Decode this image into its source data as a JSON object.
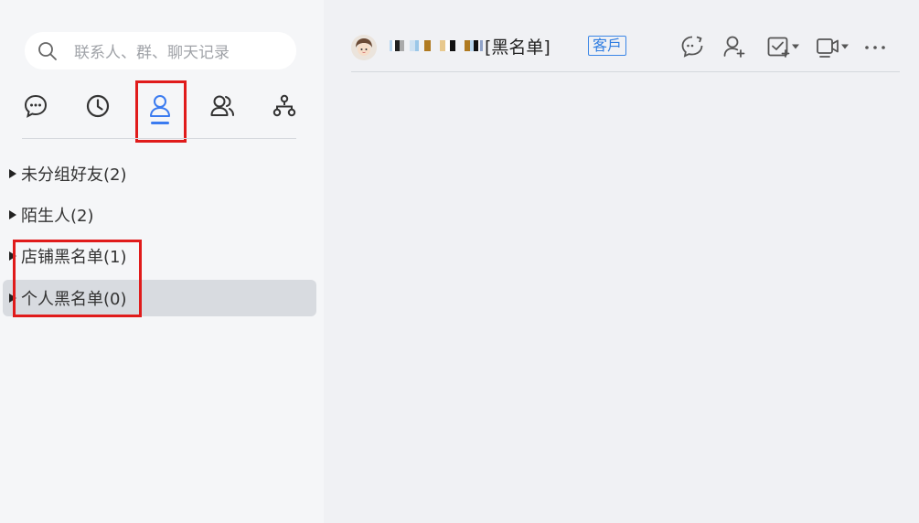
{
  "search": {
    "placeholder": "联系人、群、聊天记录"
  },
  "nav": {
    "tabs": [
      {
        "name": "messages",
        "icon": "chat-bubble-icon"
      },
      {
        "name": "recent",
        "icon": "clock-icon"
      },
      {
        "name": "contacts",
        "icon": "person-icon",
        "active": true
      },
      {
        "name": "groups",
        "icon": "people-icon"
      },
      {
        "name": "organization",
        "icon": "org-chart-icon"
      }
    ]
  },
  "groups": {
    "items": [
      {
        "label": "未分组好友(2)"
      },
      {
        "label": "陌生人(2)"
      },
      {
        "label": "店铺黑名单(1)"
      },
      {
        "label": "个人黑名单(0)",
        "selected": true
      }
    ]
  },
  "chat_header": {
    "contact_suffix": "[黑名单]",
    "tag": "客戶"
  },
  "colors": {
    "accent": "#3b7bf0",
    "highlight": "#e01b1b",
    "selected_bg": "#d8dbe0"
  }
}
